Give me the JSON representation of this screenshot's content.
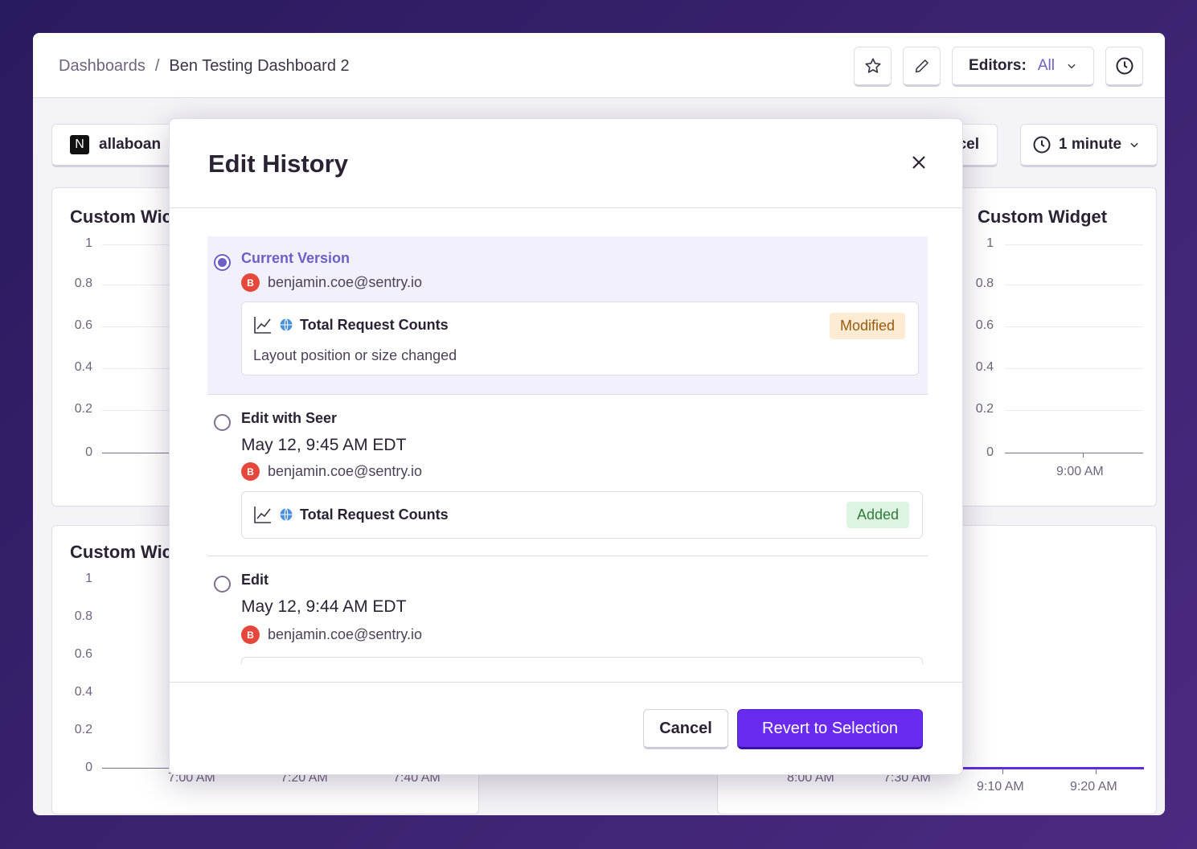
{
  "breadcrumb": {
    "root": "Dashboards",
    "separator": "/",
    "current": "Ben Testing Dashboard 2"
  },
  "toolbar": {
    "editors_label": "Editors:",
    "editors_value": "All"
  },
  "filters": {
    "project_initial": "N",
    "project_name": "allaboan",
    "partial_label": "cel",
    "refresh_interval": "1 minute"
  },
  "widgets": {
    "top_left_title": "Custom Wic",
    "top_right_title": "Custom Widget",
    "bottom_left_title": "Custom Wic",
    "y_ticks": [
      "1",
      "0.8",
      "0.6",
      "0.4",
      "0.2",
      "0"
    ],
    "top_right_x": "9:00 AM",
    "bottom_left_x": [
      "7:00 AM",
      "7:20 AM",
      "7:40 AM"
    ],
    "bottom_mid_x": [
      "8:00 AM",
      "7:30 AM"
    ],
    "bottom_right_x": [
      "9:10 AM",
      "9:20 AM"
    ]
  },
  "modal": {
    "title": "Edit History",
    "entries": [
      {
        "title": "Current Version",
        "user_initial": "B",
        "user": "benjamin.coe@sentry.io",
        "widget": "Total Request Counts",
        "badge": "Modified",
        "description": "Layout position or size changed"
      },
      {
        "title": "Edit with Seer",
        "date": "May 12, 9:45 AM EDT",
        "user_initial": "B",
        "user": "benjamin.coe@sentry.io",
        "widget": "Total Request Counts",
        "badge": "Added"
      },
      {
        "title": "Edit",
        "date": "May 12, 9:44 AM EDT",
        "user_initial": "B",
        "user": "benjamin.coe@sentry.io"
      }
    ],
    "cancel_label": "Cancel",
    "revert_label": "Revert to Selection"
  },
  "colors": {
    "accent": "#6c5fc7",
    "primary_button": "#6a2bf0",
    "avatar": "#e5483b"
  }
}
